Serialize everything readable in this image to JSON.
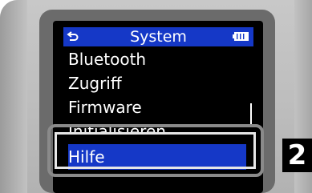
{
  "header": {
    "title": "System",
    "back_icon": "back-arrow-icon",
    "battery_icon": "battery-icon"
  },
  "menu": {
    "items": [
      {
        "label": "Bluetooth"
      },
      {
        "label": "Zugriff"
      },
      {
        "label": "Firmware"
      },
      {
        "label": "Initialisieren"
      },
      {
        "label": "Hilfe",
        "selected": true
      }
    ]
  },
  "annotation": {
    "step": "2"
  },
  "colors": {
    "highlight": "#1538c7",
    "screen_bg": "#000000",
    "bezel": "#6b6b6b",
    "focus_frame": "#8a8a8a"
  }
}
